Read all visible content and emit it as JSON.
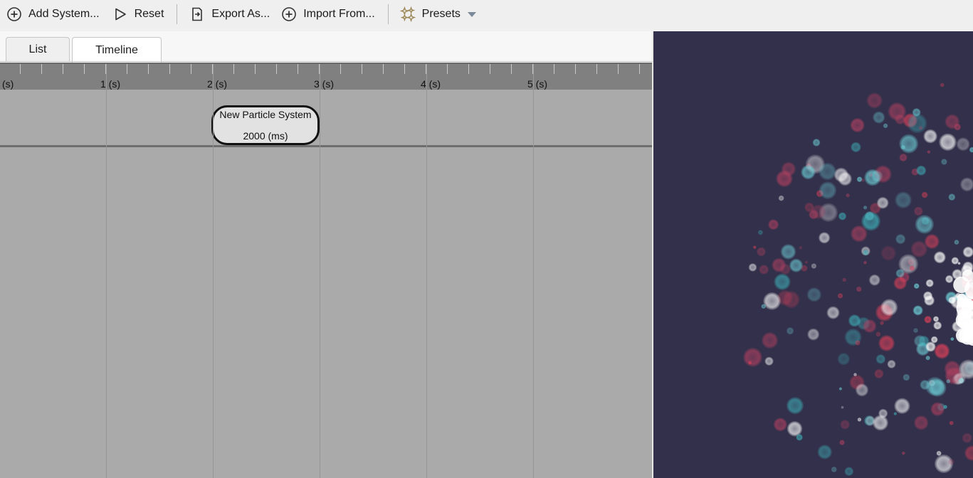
{
  "toolbar": {
    "add_system": "Add System...",
    "reset": "Reset",
    "export_as": "Export As...",
    "import_from": "Import From...",
    "presets": "Presets"
  },
  "tabs": [
    {
      "label": "List",
      "active": false
    },
    {
      "label": "Timeline",
      "active": true
    }
  ],
  "timeline": {
    "ruler_labels": [
      "(s)",
      "1 (s)",
      "2 (s)",
      "3 (s)",
      "4 (s)",
      "5 (s)"
    ],
    "systems": [
      {
        "name": "New Particle System",
        "duration": "2000 (ms)"
      }
    ]
  },
  "preview": {
    "background": "#32304a",
    "particle_colors": [
      "#3fb8c0",
      "#e0405a",
      "#ffffff",
      "#6fd4dc",
      "#b04060"
    ]
  },
  "colors": {
    "timeline_bg": "#aaaaaa",
    "ruler_bg": "#808080",
    "toolbar_bg": "#efefef"
  }
}
